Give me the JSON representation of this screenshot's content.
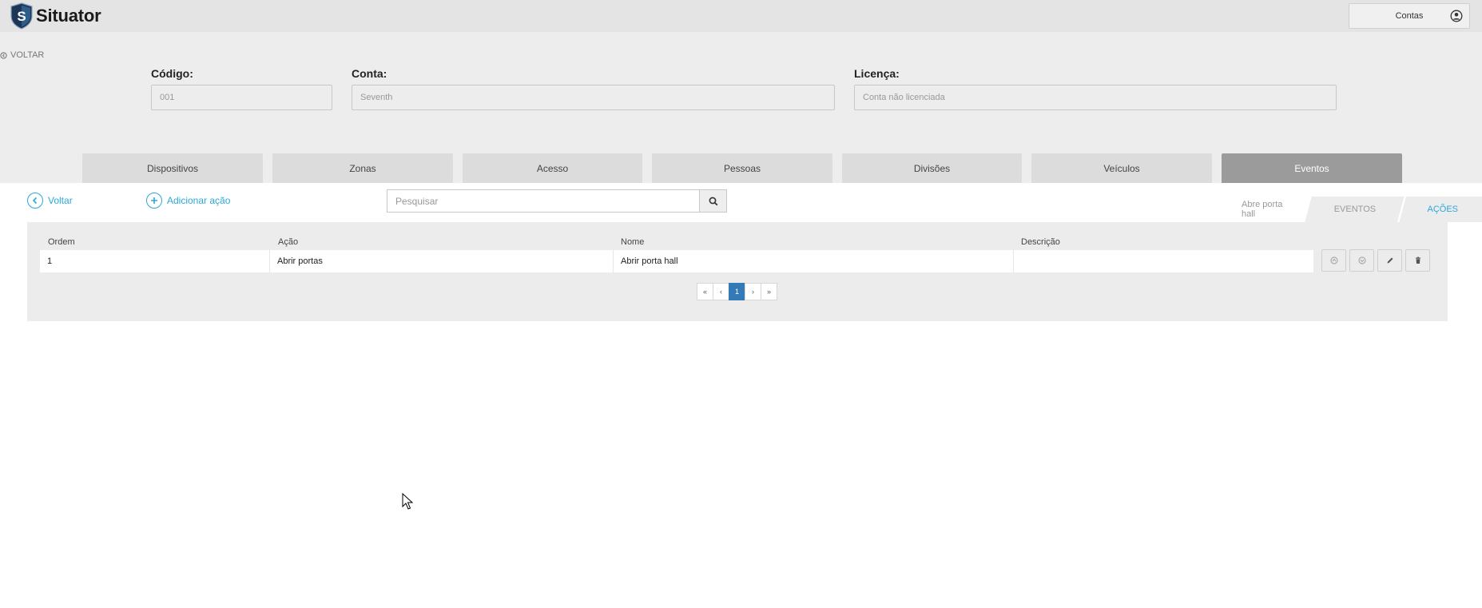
{
  "app": {
    "name": "Situator"
  },
  "account": {
    "label": "Contas"
  },
  "header": {
    "back_label": "VOLTAR",
    "fields": {
      "codigo": {
        "label": "Código:",
        "value": "001"
      },
      "conta": {
        "label": "Conta:",
        "value": "Seventh"
      },
      "licenca": {
        "label": "Licença:",
        "value": "Conta não licenciada"
      }
    }
  },
  "tabs": [
    {
      "label": "Dispositivos"
    },
    {
      "label": "Zonas"
    },
    {
      "label": "Acesso"
    },
    {
      "label": "Pessoas"
    },
    {
      "label": "Divisões"
    },
    {
      "label": "Veículos"
    },
    {
      "label": "Eventos"
    }
  ],
  "active_tab": "Eventos",
  "toolbar": {
    "back_label": "Voltar",
    "add_label": "Adicionar ação",
    "search_placeholder": "Pesquisar"
  },
  "breadcrumb": {
    "current": "Abre porta hall",
    "eventos": "EVENTOS",
    "acoes": "AÇÕES"
  },
  "table": {
    "columns": [
      "Ordem",
      "Ação",
      "Nome",
      "Descrição"
    ],
    "rows": [
      {
        "ordem": "1",
        "acao": "Abrir portas",
        "nome": "Abrir porta hall",
        "descricao": ""
      }
    ]
  },
  "pagination": {
    "first": "«",
    "prev": "‹",
    "current": "1",
    "next": "›",
    "last": "»"
  },
  "colors": {
    "accent": "#2aa8d9",
    "active_tab": "#9b9b9b",
    "page_active": "#337ab7"
  }
}
